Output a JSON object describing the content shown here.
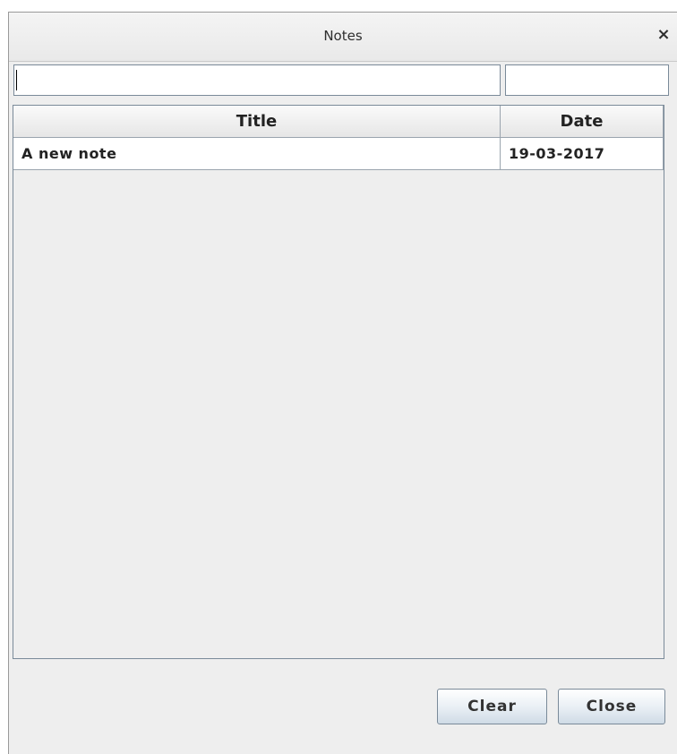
{
  "window": {
    "title": "Notes",
    "close_glyph": "×"
  },
  "filters": {
    "title_value": "",
    "date_value": ""
  },
  "table": {
    "columns": [
      "Title",
      "Date"
    ],
    "rows": [
      {
        "title": "A new note",
        "date": "19-03-2017"
      }
    ]
  },
  "buttons": {
    "clear_label": "Clear",
    "close_label": "Close"
  }
}
